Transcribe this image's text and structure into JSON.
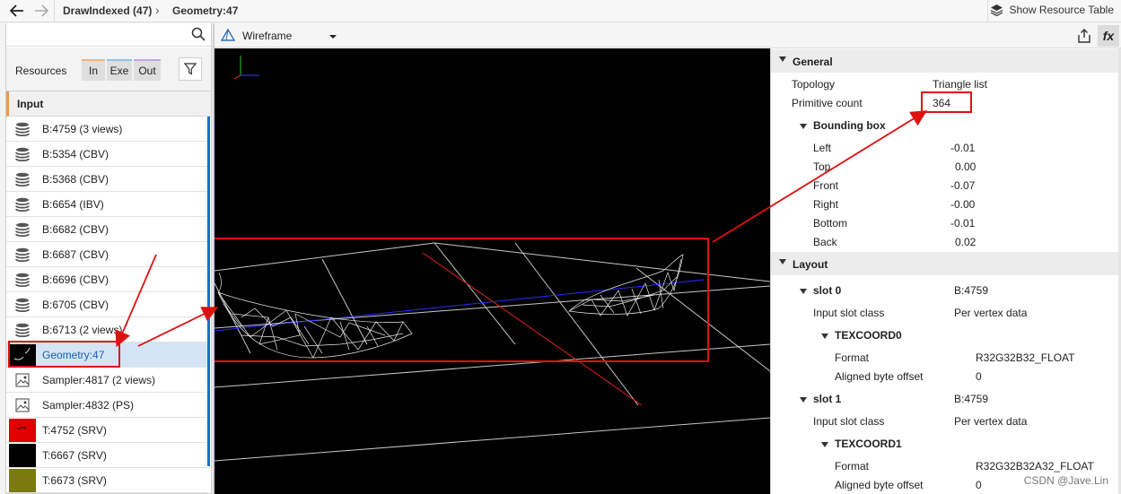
{
  "topbar": {
    "breadcrumb": [
      "DrawIndexed (47)",
      "Geometry:47"
    ],
    "show_resource_table": "Show Resource Table"
  },
  "left_panel": {
    "resources_label": "Resources",
    "toggles": [
      "In",
      "Exe",
      "Out"
    ],
    "section_header": "Input",
    "items": [
      {
        "label": "B:4759 (3 views)",
        "icon": "buffer-icon"
      },
      {
        "label": "B:5354 (CBV)",
        "icon": "buffer-icon"
      },
      {
        "label": "B:5368 (CBV)",
        "icon": "buffer-icon"
      },
      {
        "label": "B:6654 (IBV)",
        "icon": "buffer-icon"
      },
      {
        "label": "B:6682 (CBV)",
        "icon": "buffer-icon"
      },
      {
        "label": "B:6687 (CBV)",
        "icon": "buffer-icon"
      },
      {
        "label": "B:6696 (CBV)",
        "icon": "buffer-icon"
      },
      {
        "label": "B:6705 (CBV)",
        "icon": "buffer-icon"
      },
      {
        "label": "B:6713 (2 views)",
        "icon": "buffer-icon"
      },
      {
        "label": "Geometry:47",
        "icon": "geometry-thumbnail",
        "selected": true
      },
      {
        "label": "Sampler:4817 (2 views)",
        "icon": "sampler-icon"
      },
      {
        "label": "Sampler:4832 (PS)",
        "icon": "sampler-icon"
      },
      {
        "label": "T:4752 (SRV)",
        "icon": "texture-thumbnail",
        "color": "#e00000"
      },
      {
        "label": "T:6667 (SRV)",
        "icon": "texture-thumbnail",
        "color": "#000000"
      },
      {
        "label": "T:6673 (SRV)",
        "icon": "texture-thumbnail",
        "color": "#7a7a10"
      }
    ]
  },
  "viewport": {
    "mode": "Wireframe"
  },
  "properties": {
    "general": {
      "title": "General",
      "topology_label": "Topology",
      "topology_value": "Triangle list",
      "primitive_count_label": "Primitive count",
      "primitive_count_value": "364",
      "bbox_title": "Bounding box",
      "bbox": [
        {
          "k": "Left",
          "v": "-0.01"
        },
        {
          "k": "Top",
          "v": "0.00"
        },
        {
          "k": "Front",
          "v": "-0.07"
        },
        {
          "k": "Right",
          "v": "-0.00"
        },
        {
          "k": "Bottom",
          "v": "-0.01"
        },
        {
          "k": "Back",
          "v": "0.02"
        }
      ]
    },
    "layout": {
      "title": "Layout",
      "slots": [
        {
          "name": "slot 0",
          "buffer": "B:4759",
          "input_slot_class_label": "Input slot class",
          "input_slot_class": "Per vertex data",
          "semantic": "TEXCOORD0",
          "format_label": "Format",
          "format": "R32G32B32_FLOAT",
          "offset_label": "Aligned byte offset",
          "offset": "0"
        },
        {
          "name": "slot 1",
          "buffer": "B:4759",
          "input_slot_class_label": "Input slot class",
          "input_slot_class": "Per vertex data",
          "semantic": "TEXCOORD1",
          "format_label": "Format",
          "format": "R32G32B32A32_FLOAT",
          "offset_label": "Aligned byte offset",
          "offset": "0"
        }
      ]
    }
  },
  "watermark": "CSDN @Jave.Lin",
  "colors": {
    "annotation": "#e01010",
    "accent": "#1e6ec8",
    "selected_bg": "#d4e4f4"
  }
}
